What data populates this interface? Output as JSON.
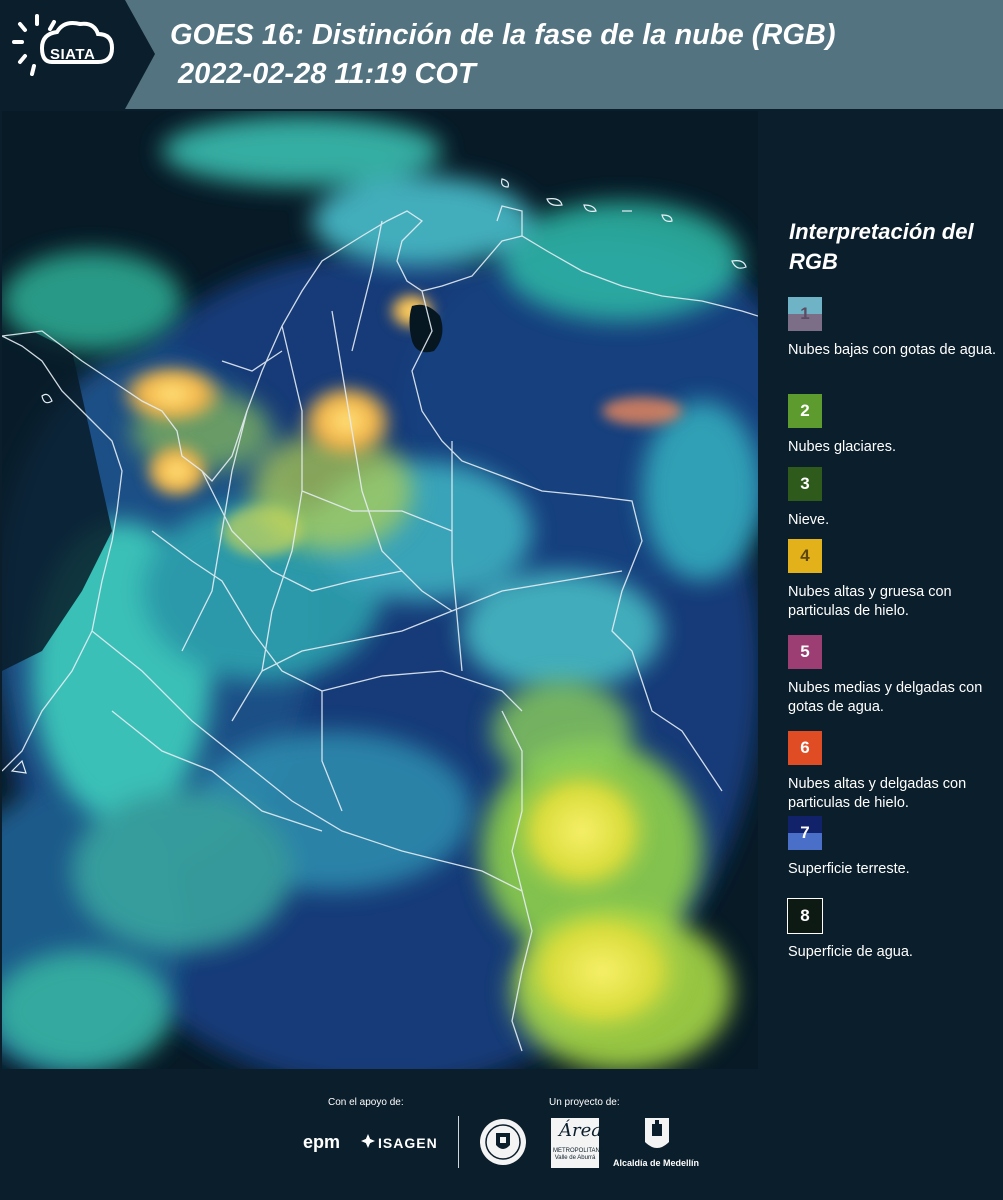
{
  "header": {
    "logo_text": "SIATA",
    "title": "GOES 16: Distinción de la fase de la nube (RGB)",
    "datetime": "2022-02-28 11:19 COT"
  },
  "legend": {
    "title": "Interpretación del RGB",
    "items": [
      {
        "number": "1",
        "label": "Nubes bajas con gotas de agua.",
        "color_top": "#6fb3c6",
        "color_bottom": "#7b6e86",
        "num_color": "#5a4d63"
      },
      {
        "number": "2",
        "label": "Nubes glaciares.",
        "color_top": "#5e9b2e",
        "color_bottom": "#5e9b2e",
        "num_color": "#ffffff"
      },
      {
        "number": "3",
        "label": "Nieve.",
        "color_top": "#2e5a1c",
        "color_bottom": "#2e5a1c",
        "num_color": "#ffffff"
      },
      {
        "number": "4",
        "label": "Nubes altas y gruesa con particulas de hielo.",
        "color_top": "#e3b21a",
        "color_bottom": "#e3b21a",
        "num_color": "#5c4610"
      },
      {
        "number": "5",
        "label": "Nubes medias y delgadas con gotas de agua.",
        "color_top": "#9c3e73",
        "color_bottom": "#9c3e73",
        "num_color": "#ffffff"
      },
      {
        "number": "6",
        "label": "Nubes altas y delgadas con particulas de hielo.",
        "color_top": "#e04d24",
        "color_bottom": "#e04d24",
        "num_color": "#ffffff"
      },
      {
        "number": "7",
        "label": "Superficie terreste.",
        "color_top": "#12226a",
        "color_bottom": "#4a6fc9",
        "num_color": "#ffffff"
      },
      {
        "number": "8",
        "label": "Superficie de agua.",
        "color_top": "#0d1a14",
        "color_bottom": "#0d1a14",
        "num_color": "#ffffff"
      }
    ]
  },
  "footer": {
    "support_label": "Con el apoyo de:",
    "project_label": "Un proyecto de:",
    "epm": "epm",
    "isagen": "ISAGEN",
    "area_script": "Área",
    "area_sub": "METROPOLITANA Valle de Aburrá",
    "medellin": "Alcaldía de Medellín"
  },
  "colors": {
    "header_bg": "#52737f",
    "page_bg": "#0b1e2b",
    "map_water": "#071a26",
    "map_land": "#123a78",
    "cloud_cyan": "#3fd4c0",
    "cloud_yellow": "#e9e24a"
  }
}
